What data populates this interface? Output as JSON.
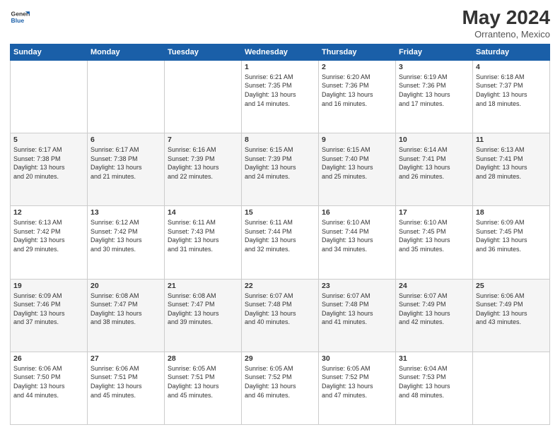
{
  "logo": {
    "line1": "General",
    "line2": "Blue"
  },
  "title": "May 2024",
  "subtitle": "Orranteno, Mexico",
  "header_days": [
    "Sunday",
    "Monday",
    "Tuesday",
    "Wednesday",
    "Thursday",
    "Friday",
    "Saturday"
  ],
  "weeks": [
    [
      {
        "day": "",
        "info": ""
      },
      {
        "day": "",
        "info": ""
      },
      {
        "day": "",
        "info": ""
      },
      {
        "day": "1",
        "info": "Sunrise: 6:21 AM\nSunset: 7:35 PM\nDaylight: 13 hours\nand 14 minutes."
      },
      {
        "day": "2",
        "info": "Sunrise: 6:20 AM\nSunset: 7:36 PM\nDaylight: 13 hours\nand 16 minutes."
      },
      {
        "day": "3",
        "info": "Sunrise: 6:19 AM\nSunset: 7:36 PM\nDaylight: 13 hours\nand 17 minutes."
      },
      {
        "day": "4",
        "info": "Sunrise: 6:18 AM\nSunset: 7:37 PM\nDaylight: 13 hours\nand 18 minutes."
      }
    ],
    [
      {
        "day": "5",
        "info": "Sunrise: 6:17 AM\nSunset: 7:38 PM\nDaylight: 13 hours\nand 20 minutes."
      },
      {
        "day": "6",
        "info": "Sunrise: 6:17 AM\nSunset: 7:38 PM\nDaylight: 13 hours\nand 21 minutes."
      },
      {
        "day": "7",
        "info": "Sunrise: 6:16 AM\nSunset: 7:39 PM\nDaylight: 13 hours\nand 22 minutes."
      },
      {
        "day": "8",
        "info": "Sunrise: 6:15 AM\nSunset: 7:39 PM\nDaylight: 13 hours\nand 24 minutes."
      },
      {
        "day": "9",
        "info": "Sunrise: 6:15 AM\nSunset: 7:40 PM\nDaylight: 13 hours\nand 25 minutes."
      },
      {
        "day": "10",
        "info": "Sunrise: 6:14 AM\nSunset: 7:41 PM\nDaylight: 13 hours\nand 26 minutes."
      },
      {
        "day": "11",
        "info": "Sunrise: 6:13 AM\nSunset: 7:41 PM\nDaylight: 13 hours\nand 28 minutes."
      }
    ],
    [
      {
        "day": "12",
        "info": "Sunrise: 6:13 AM\nSunset: 7:42 PM\nDaylight: 13 hours\nand 29 minutes."
      },
      {
        "day": "13",
        "info": "Sunrise: 6:12 AM\nSunset: 7:42 PM\nDaylight: 13 hours\nand 30 minutes."
      },
      {
        "day": "14",
        "info": "Sunrise: 6:11 AM\nSunset: 7:43 PM\nDaylight: 13 hours\nand 31 minutes."
      },
      {
        "day": "15",
        "info": "Sunrise: 6:11 AM\nSunset: 7:44 PM\nDaylight: 13 hours\nand 32 minutes."
      },
      {
        "day": "16",
        "info": "Sunrise: 6:10 AM\nSunset: 7:44 PM\nDaylight: 13 hours\nand 34 minutes."
      },
      {
        "day": "17",
        "info": "Sunrise: 6:10 AM\nSunset: 7:45 PM\nDaylight: 13 hours\nand 35 minutes."
      },
      {
        "day": "18",
        "info": "Sunrise: 6:09 AM\nSunset: 7:45 PM\nDaylight: 13 hours\nand 36 minutes."
      }
    ],
    [
      {
        "day": "19",
        "info": "Sunrise: 6:09 AM\nSunset: 7:46 PM\nDaylight: 13 hours\nand 37 minutes."
      },
      {
        "day": "20",
        "info": "Sunrise: 6:08 AM\nSunset: 7:47 PM\nDaylight: 13 hours\nand 38 minutes."
      },
      {
        "day": "21",
        "info": "Sunrise: 6:08 AM\nSunset: 7:47 PM\nDaylight: 13 hours\nand 39 minutes."
      },
      {
        "day": "22",
        "info": "Sunrise: 6:07 AM\nSunset: 7:48 PM\nDaylight: 13 hours\nand 40 minutes."
      },
      {
        "day": "23",
        "info": "Sunrise: 6:07 AM\nSunset: 7:48 PM\nDaylight: 13 hours\nand 41 minutes."
      },
      {
        "day": "24",
        "info": "Sunrise: 6:07 AM\nSunset: 7:49 PM\nDaylight: 13 hours\nand 42 minutes."
      },
      {
        "day": "25",
        "info": "Sunrise: 6:06 AM\nSunset: 7:49 PM\nDaylight: 13 hours\nand 43 minutes."
      }
    ],
    [
      {
        "day": "26",
        "info": "Sunrise: 6:06 AM\nSunset: 7:50 PM\nDaylight: 13 hours\nand 44 minutes."
      },
      {
        "day": "27",
        "info": "Sunrise: 6:06 AM\nSunset: 7:51 PM\nDaylight: 13 hours\nand 45 minutes."
      },
      {
        "day": "28",
        "info": "Sunrise: 6:05 AM\nSunset: 7:51 PM\nDaylight: 13 hours\nand 45 minutes."
      },
      {
        "day": "29",
        "info": "Sunrise: 6:05 AM\nSunset: 7:52 PM\nDaylight: 13 hours\nand 46 minutes."
      },
      {
        "day": "30",
        "info": "Sunrise: 6:05 AM\nSunset: 7:52 PM\nDaylight: 13 hours\nand 47 minutes."
      },
      {
        "day": "31",
        "info": "Sunrise: 6:04 AM\nSunset: 7:53 PM\nDaylight: 13 hours\nand 48 minutes."
      },
      {
        "day": "",
        "info": ""
      }
    ]
  ]
}
